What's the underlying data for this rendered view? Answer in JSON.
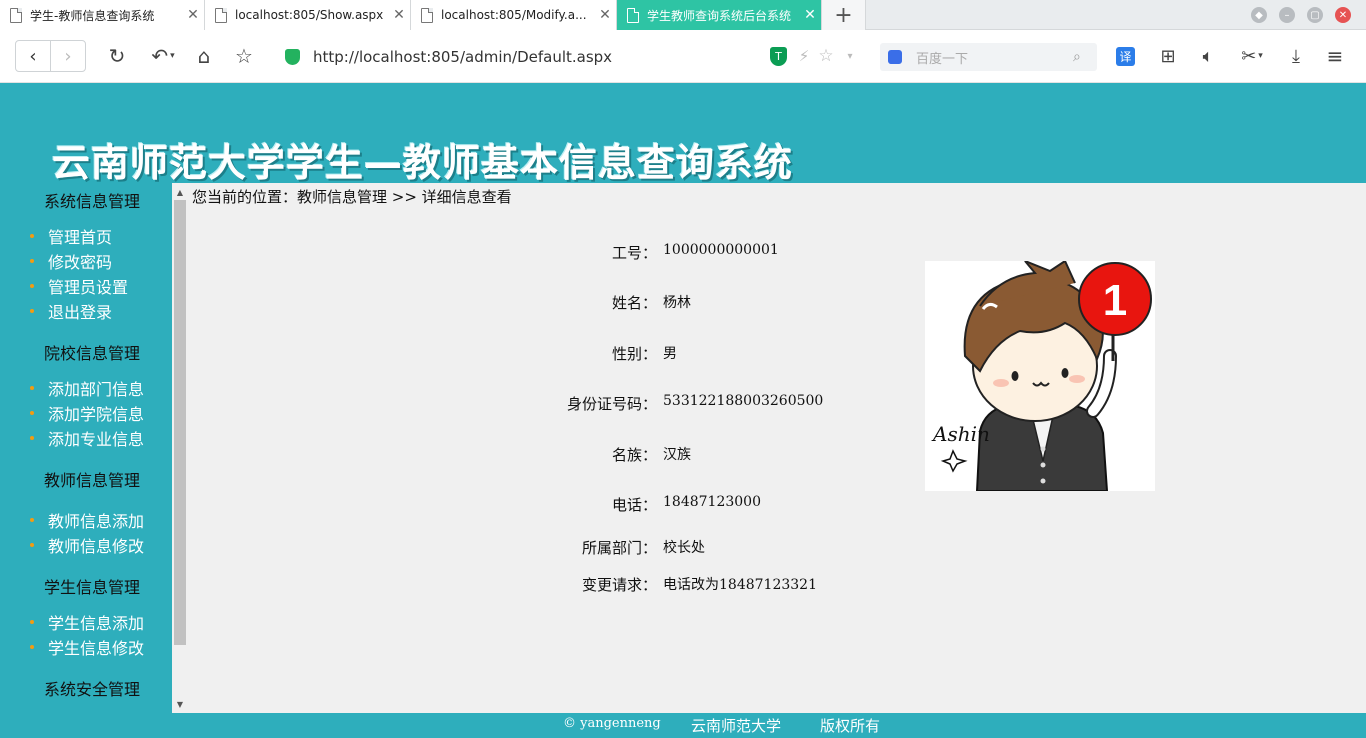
{
  "browser": {
    "tabs": [
      {
        "title": "学生-教师信息查询系统",
        "active": false
      },
      {
        "title": "localhost:805/Show.aspx",
        "active": false
      },
      {
        "title": "localhost:805/Modify.a...",
        "active": false
      },
      {
        "title": "学生教师查询系统后台系统",
        "active": true
      }
    ],
    "url": "http://localhost:805/admin/Default.aspx",
    "search_placeholder": "百度一下",
    "translate_label": "译"
  },
  "site": {
    "title": "云南师范大学学生—教师基本信息查询系统"
  },
  "sidebar": {
    "groups": [
      {
        "heading": "系统信息管理",
        "items": [
          "管理首页",
          "修改密码",
          "管理员设置",
          "退出登录"
        ]
      },
      {
        "heading": "院校信息管理",
        "items": [
          "添加部门信息",
          "添加学院信息",
          "添加专业信息"
        ]
      },
      {
        "heading": "教师信息管理",
        "items": [
          "教师信息添加",
          "教师信息修改"
        ]
      },
      {
        "heading": "学生信息管理",
        "items": [
          "学生信息添加",
          "学生信息修改"
        ]
      },
      {
        "heading": "系统安全管理",
        "items": []
      }
    ]
  },
  "breadcrumb": "您当前的位置：教师信息管理 >> 详细信息查看",
  "teacher": {
    "fields": [
      {
        "label": "工号：",
        "value": "1000000000001"
      },
      {
        "label": "姓名：",
        "value": "杨林"
      },
      {
        "label": "性别：",
        "value": "男"
      },
      {
        "label": "身份证号码：",
        "value": "533122188003260500"
      },
      {
        "label": "名族：",
        "value": "汉族"
      },
      {
        "label": "电话：",
        "value": "18487123000"
      },
      {
        "label": "所属部门：",
        "value": "校长处"
      },
      {
        "label": "变更请求：",
        "value": "电话改为18487123321"
      }
    ],
    "photo_signature": "Ashin",
    "photo_badge": "1"
  },
  "footer": {
    "author": "© yangenneng",
    "school": "云南师范大学",
    "rights": "版权所有"
  },
  "colors": {
    "theme": "#2eaebc",
    "active_tab": "#2ec4a4",
    "bullet": "#f39c12"
  }
}
